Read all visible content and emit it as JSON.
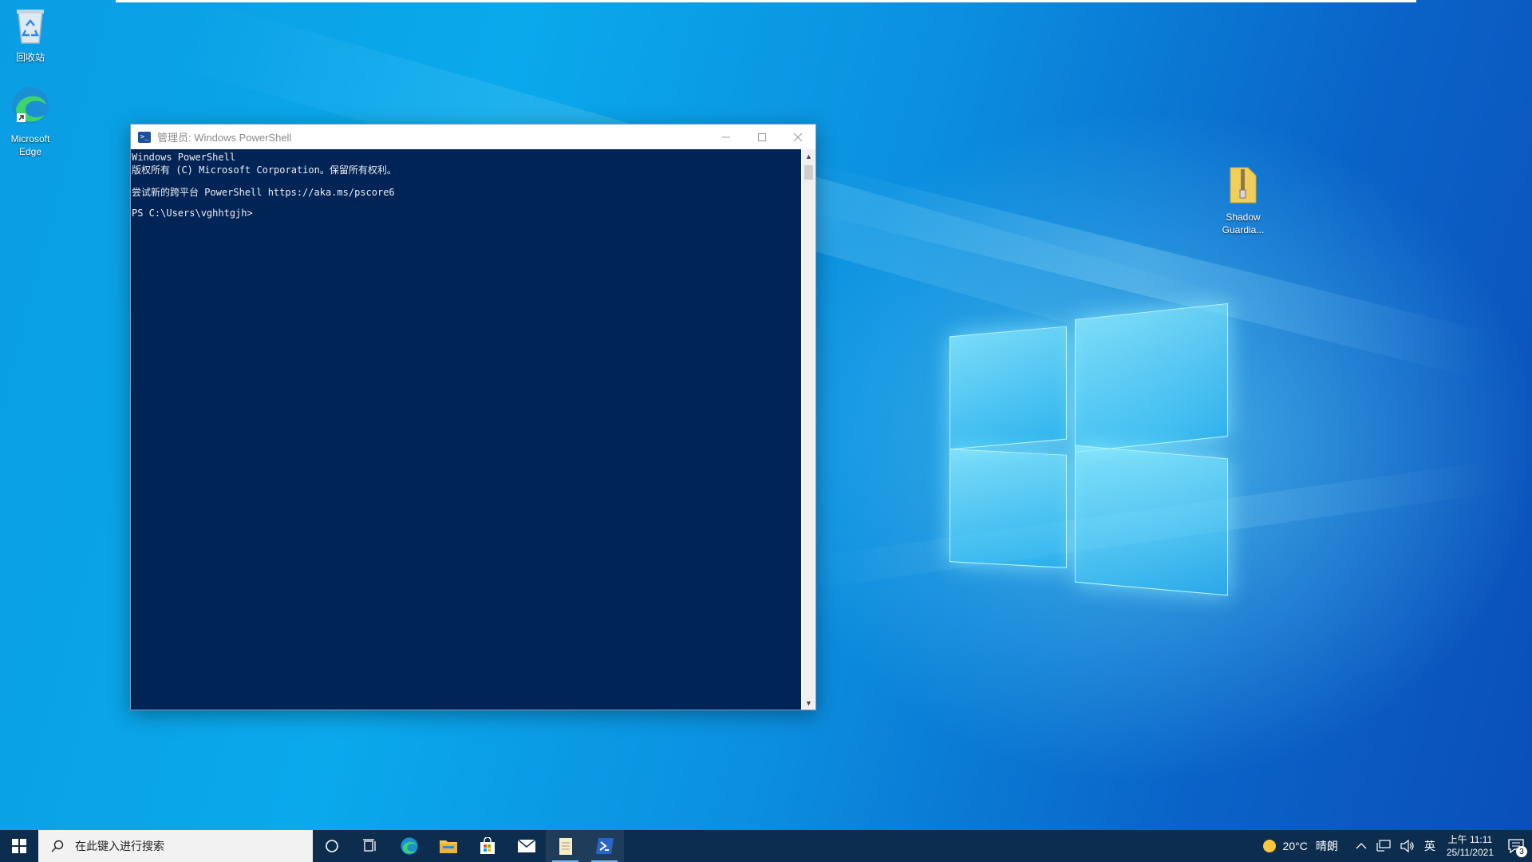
{
  "desktop": {
    "icons": [
      {
        "label": "回收站",
        "icon": "recycle-bin-icon"
      },
      {
        "label": "Microsoft Edge",
        "icon": "edge-icon"
      },
      {
        "label": "Shadow Guardia...",
        "icon": "zip-folder-icon"
      }
    ]
  },
  "powershell_window": {
    "title": "管理员: Windows PowerShell",
    "console_lines": [
      "Windows PowerShell",
      "版权所有 (C) Microsoft Corporation。保留所有权利。",
      "",
      "尝试新的跨平台 PowerShell https://aka.ms/pscore6",
      "",
      "PS C:\\Users\\vghhtgjh>"
    ],
    "colors": {
      "console_bg": "#012456",
      "console_fg": "#eeedf0"
    }
  },
  "taskbar": {
    "search_placeholder": "在此键入进行搜索",
    "apps": [
      "cortana-icon",
      "task-view-icon",
      "edge-icon",
      "file-explorer-icon",
      "store-icon",
      "mail-icon",
      "notepad-icon",
      "powershell-icon"
    ],
    "weather": {
      "temp": "20°C",
      "condition": "晴朗"
    },
    "ime": "英",
    "clock": {
      "time": "上午 11:11",
      "date": "25/11/2021"
    },
    "notification_count": "3"
  }
}
